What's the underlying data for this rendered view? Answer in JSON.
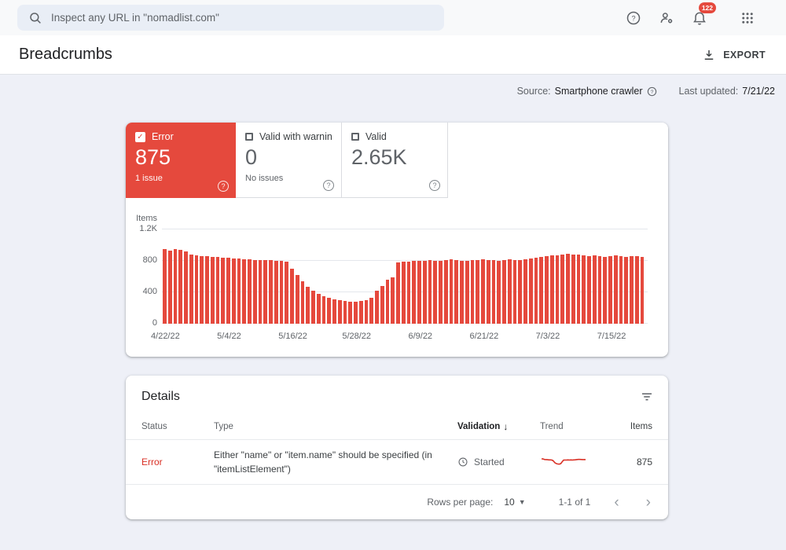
{
  "topbar": {
    "search_placeholder": "Inspect any URL in \"nomadlist.com\"",
    "notification_badge": "122"
  },
  "page": {
    "title": "Breadcrumbs",
    "export_label": "EXPORT"
  },
  "meta": {
    "source_label": "Source:",
    "source_value": "Smartphone crawler",
    "updated_label": "Last updated:",
    "updated_value": "7/21/22"
  },
  "tiles": {
    "error": {
      "label": "Error",
      "value": "875",
      "sub": "1 issue"
    },
    "warning": {
      "label": "Valid with warnin…",
      "value": "0",
      "sub": "No issues"
    },
    "valid": {
      "label": "Valid",
      "value": "2.65K",
      "sub": ""
    }
  },
  "chart_data": {
    "type": "bar",
    "series_name": "Error items",
    "ylabel": "Items",
    "ymax": 1200,
    "yticks": [
      {
        "label": "1.2K",
        "value": 1200
      },
      {
        "label": "800",
        "value": 800
      },
      {
        "label": "400",
        "value": 400
      },
      {
        "label": "0",
        "value": 0
      }
    ],
    "x_tick_labels": [
      "4/22/22",
      "5/4/22",
      "5/16/22",
      "5/28/22",
      "6/9/22",
      "6/21/22",
      "7/3/22",
      "7/15/22"
    ],
    "x_tick_positions": [
      0,
      12,
      24,
      36,
      48,
      60,
      72,
      84
    ],
    "bar_color": "#e5493d",
    "values": [
      950,
      935,
      955,
      940,
      920,
      880,
      870,
      865,
      860,
      855,
      850,
      845,
      840,
      835,
      830,
      825,
      820,
      815,
      815,
      810,
      810,
      805,
      800,
      790,
      700,
      620,
      540,
      470,
      420,
      380,
      350,
      330,
      310,
      300,
      290,
      285,
      280,
      290,
      300,
      330,
      420,
      480,
      560,
      590,
      780,
      790,
      795,
      800,
      805,
      800,
      810,
      805,
      800,
      810,
      820,
      815,
      805,
      800,
      810,
      815,
      820,
      815,
      810,
      805,
      815,
      820,
      815,
      810,
      820,
      830,
      840,
      850,
      860,
      870,
      875,
      880,
      890,
      885,
      880,
      870,
      860,
      870,
      865,
      855,
      860,
      870,
      865,
      855,
      860,
      865,
      855
    ]
  },
  "details": {
    "title": "Details",
    "columns": {
      "status": "Status",
      "type": "Type",
      "validation": "Validation",
      "trend": "Trend",
      "items": "Items"
    },
    "rows": [
      {
        "status": "Error",
        "type": "Either \"name\" or \"item.name\" should be specified (in \"itemListElement\")",
        "validation": "Started",
        "items": "875"
      }
    ],
    "footer": {
      "rows_per_page_label": "Rows per page:",
      "rows_per_page_value": "10",
      "range": "1-1 of 1"
    }
  },
  "colors": {
    "error_tile": "#e5493d",
    "error_text": "#d93025",
    "bar_red": "#e5493d",
    "content_background": "#eef0f7"
  }
}
